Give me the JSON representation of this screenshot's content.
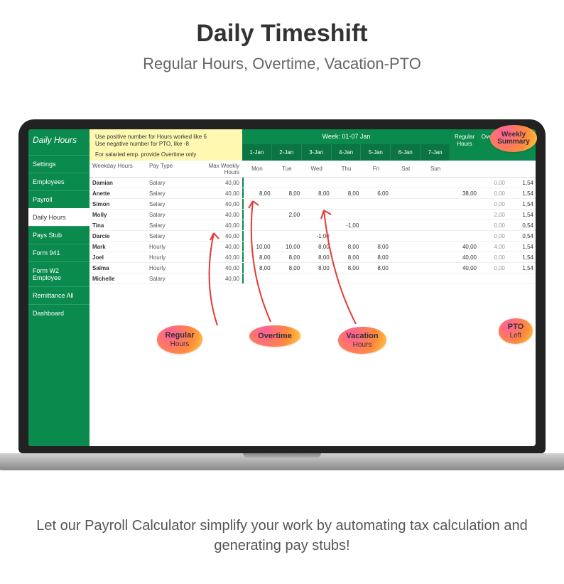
{
  "page": {
    "title": "Daily Timeshift",
    "subtitle": "Regular Hours, Overtime, Vacation-PTO",
    "footer": "Let our Payroll Calculator simplify your work by automating tax calculation and generating pay stubs!"
  },
  "sidebar": {
    "title": "Daily Hours",
    "items": [
      "Settings",
      "Employees",
      "Payroll",
      "Daily Hours",
      "Pays Stub",
      "Form 941",
      "Form W2 Employee",
      "Remittance All",
      "Dashboard"
    ],
    "active_index": 3
  },
  "hint": {
    "line1": "Use positive number for Hours worked like 6",
    "line2": "Use negative number for PTO, like -8",
    "line3": "For salaried emp. provide Overtime only"
  },
  "week_label": "Week: 01-07 Jan",
  "dates": [
    "1-Jan",
    "2-Jan",
    "3-Jan",
    "4-Jan",
    "5-Jan",
    "6-Jan",
    "7-Jan"
  ],
  "daynames": [
    "Mon",
    "Tue",
    "Wed",
    "Thu",
    "Fri",
    "Sat",
    "Sun"
  ],
  "cols": {
    "name": "Weekday Hours",
    "pay": "Pay Type",
    "max": "Max Weekly Hours"
  },
  "summary_cols": [
    "Regular Hours",
    "Overtime",
    "PTO Left"
  ],
  "rows": [
    {
      "name": "Damian",
      "pay": "Salary",
      "max": "40,00",
      "d": [
        "",
        "",
        "",
        "",
        "",
        "",
        ""
      ],
      "reg": "",
      "ot": "0,00",
      "pto": "1,54"
    },
    {
      "name": "Anette",
      "pay": "Salary",
      "max": "40,00",
      "d": [
        "8,00",
        "8,00",
        "8,00",
        "8,00",
        "6,00",
        "",
        ""
      ],
      "reg": "38,00",
      "ot": "0,00",
      "pto": "1,54"
    },
    {
      "name": "Simon",
      "pay": "Salary",
      "max": "40,00",
      "d": [
        "",
        "",
        "",
        "",
        "",
        "",
        ""
      ],
      "reg": "",
      "ot": "0,00",
      "pto": "1,54"
    },
    {
      "name": "Molly",
      "pay": "Salary",
      "max": "40,00",
      "d": [
        "",
        "2,00",
        "",
        "",
        "",
        "",
        ""
      ],
      "reg": "",
      "ot": "2,00",
      "pto": "1,54"
    },
    {
      "name": "Tina",
      "pay": "Salary",
      "max": "40,00",
      "d": [
        "",
        "",
        "",
        "-1,00",
        "",
        "",
        ""
      ],
      "reg": "",
      "ot": "0,00",
      "pto": "0,54"
    },
    {
      "name": "Darcie",
      "pay": "Salary",
      "max": "40,00",
      "d": [
        "",
        "",
        "-1,00",
        "",
        "",
        "",
        ""
      ],
      "reg": "",
      "ot": "0,00",
      "pto": "0,54"
    },
    {
      "name": "Mark",
      "pay": "Hourly",
      "max": "40,00",
      "d": [
        "10,00",
        "10,00",
        "8,00",
        "8,00",
        "8,00",
        "",
        ""
      ],
      "reg": "40,00",
      "ot": "4,00",
      "pto": "1,54"
    },
    {
      "name": "Joel",
      "pay": "Hourly",
      "max": "40,00",
      "d": [
        "8,00",
        "8,00",
        "8,00",
        "8,00",
        "8,00",
        "",
        ""
      ],
      "reg": "40,00",
      "ot": "0,00",
      "pto": "1,54"
    },
    {
      "name": "Salma",
      "pay": "Hourly",
      "max": "40,00",
      "d": [
        "8,00",
        "8,00",
        "8,00",
        "8,00",
        "8,00",
        "",
        ""
      ],
      "reg": "40,00",
      "ot": "0,00",
      "pto": "1,54"
    },
    {
      "name": "Michelle",
      "pay": "Salary",
      "max": "40,00",
      "d": [
        "",
        "",
        "",
        "",
        "",
        "",
        ""
      ],
      "reg": "",
      "ot": "",
      "pto": ""
    }
  ],
  "annotations": {
    "weekly_summary": "Weekly Summary",
    "pto_left_l1": "PTO",
    "pto_left_l2": "Left",
    "regular_l1": "Regular",
    "regular_l2": "Hours",
    "overtime": "Overtime",
    "vacation_l1": "Vacation",
    "vacation_l2": "Hours"
  }
}
